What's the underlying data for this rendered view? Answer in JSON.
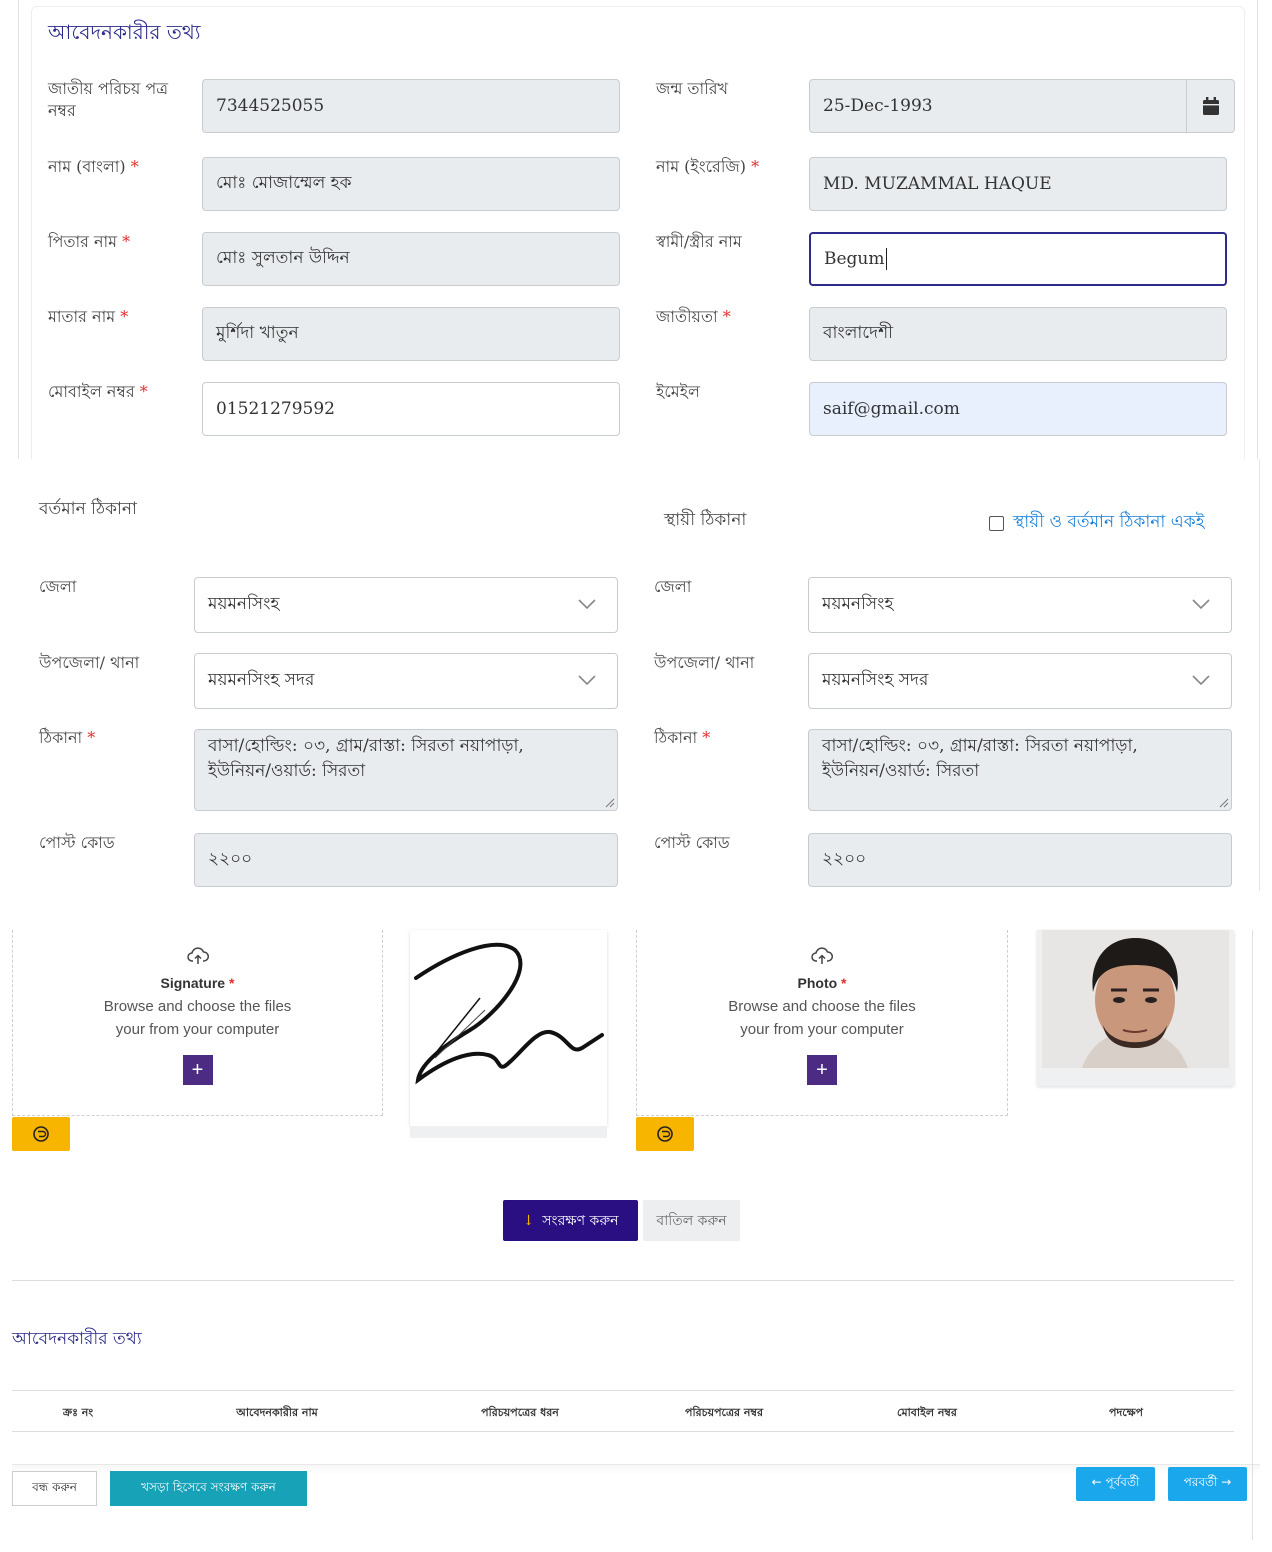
{
  "applicant": {
    "title": "আবেদনকারীর তথ্য",
    "nid_label": "জাতীয় পরিচয় পত্র নম্বর",
    "nid_value": "7344525055",
    "dob_label": "জন্ম তারিখ",
    "dob_value": "25-Dec-1993",
    "name_bn_label": "নাম (বাংলা)",
    "name_bn_value": "মোঃ মোজাম্মেল হক",
    "name_en_label": "নাম (ইংরেজি)",
    "name_en_value": "MD. MUZAMMAL HAQUE",
    "father_label": "পিতার নাম",
    "father_value": "মোঃ সুলতান উদ্দিন",
    "spouse_label": "স্বামী/স্ত্রীর নাম",
    "spouse_value": "Begum",
    "mother_label": "মাতার নাম",
    "mother_value": "মুর্শিদা খাতুন",
    "nationality_label": "জাতীয়তা",
    "nationality_value": "বাংলাদেশী",
    "mobile_label": "মোবাইল নম্বর",
    "mobile_value": "01521279592",
    "email_label": "ইমেইল",
    "email_value": "saif@gmail.com",
    "required_mark": "*"
  },
  "address": {
    "present_title": "বর্তমান ঠিকানা",
    "permanent_title": "স্থায়ী ঠিকানা",
    "same_label": "স্থায়ী ও বর্তমান ঠিকানা একই",
    "district_label": "জেলা",
    "upazila_label": "উপজেলা/ থানা",
    "address_label": "ঠিকানা",
    "postcode_label": "পোস্ট কোড",
    "present": {
      "district": "ময়মনসিংহ",
      "upazila": "ময়মনসিংহ সদর",
      "address_line1": "বাসা/হোল্ডিং: ০৩, গ্রাম/রাস্তা: সিরতা নয়াপাড়া,",
      "address_line2": "ইউনিয়ন/ওয়ার্ড: সিরতা",
      "postcode": "২২০০"
    },
    "permanent": {
      "district": "ময়মনসিংহ",
      "upazila": "ময়মনসিংহ সদর",
      "address_line1": "বাসা/হোল্ডিং: ০৩, গ্রাম/রাস্তা: সিরতা নয়াপাড়া,",
      "address_line2": "ইউনিয়ন/ওয়ার্ড: সিরতা",
      "postcode": "২২০০"
    }
  },
  "uploads": {
    "signature_title": "Signature",
    "photo_title": "Photo",
    "desc_line1": "Browse and choose the files",
    "desc_line2": "your from your computer",
    "plus": "+"
  },
  "actions": {
    "save": "সংরক্ষণ করুন",
    "cancel": "বাতিল করুন"
  },
  "applicant_table": {
    "title": "আবেদনকারীর তথ্য",
    "columns": [
      "ক্রঃ নং",
      "আবেদনকারীর নাম",
      "পরিচয়পত্রের ধরন",
      "পরিচয়পত্রের নম্বর",
      "মোবাইল নম্বর",
      "পদক্ষেপ"
    ]
  },
  "footer": {
    "close": "বন্ধ করুন",
    "save_draft": "খসড়া হিসেবে সংরক্ষণ করুন",
    "prev": "← পূর্ববর্তী",
    "next": "পরবর্তী →"
  },
  "colors": {
    "primary": "#2a0f82",
    "accent": "#17a2b8",
    "nav": "#1aa7ec",
    "rotate": "#f7b500",
    "required": "#e03030"
  }
}
